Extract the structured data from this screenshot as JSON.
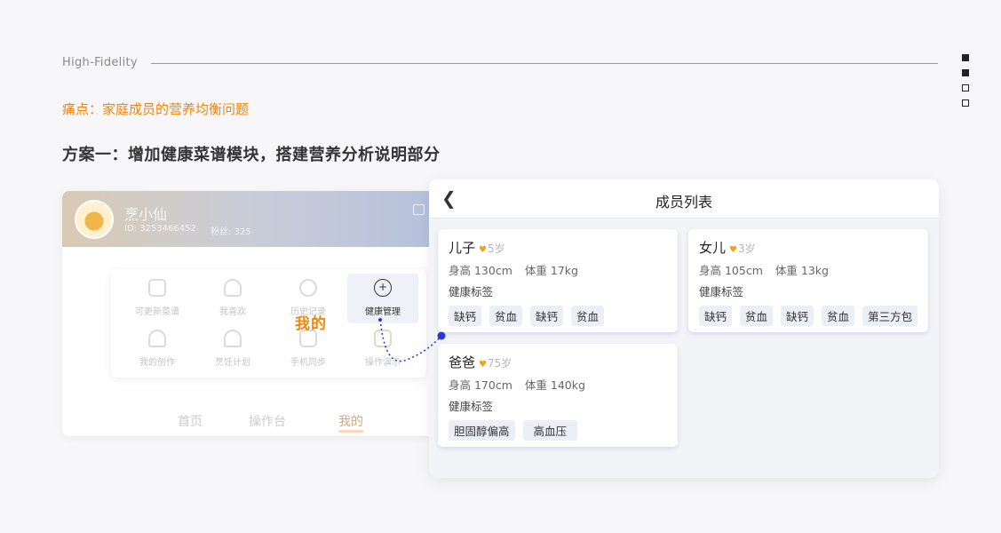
{
  "header": {
    "label": "High-Fidelity",
    "pain_point": "痛点：家庭成员的营养均衡问题",
    "plan": "方案一：增加健康菜谱模块，搭建营养分析说明部分"
  },
  "pager": {
    "total": 4,
    "active": [
      0,
      1
    ]
  },
  "profile": {
    "name": "烹小仙",
    "id": "ID: 3253466452",
    "fans": "粉丝: 325",
    "grid": [
      {
        "label": "可更新菜谱",
        "icon": "recipe-edit-icon"
      },
      {
        "label": "我喜欢",
        "icon": "heart-icon"
      },
      {
        "label": "历史记录",
        "icon": "history-icon"
      },
      {
        "label": "健康管理",
        "icon": "health-drop-icon"
      },
      {
        "label": "我的创作",
        "icon": "chef-hat-icon"
      },
      {
        "label": "烹饪计划",
        "icon": "cloche-icon"
      },
      {
        "label": "手机同步",
        "icon": "sync-icon"
      },
      {
        "label": "操作演示",
        "icon": "demo-icon"
      }
    ],
    "nav": [
      "首页",
      "操作台",
      "我的"
    ],
    "callout": "我的"
  },
  "member_list": {
    "title": "成员列表",
    "tag_title": "健康标签",
    "members": [
      {
        "name": "儿子",
        "age": "5岁",
        "height": "身高 130cm",
        "weight": "体重 17kg",
        "tags": [
          "缺钙",
          "贫血",
          "缺钙",
          "贫血"
        ]
      },
      {
        "name": "女儿",
        "age": "3岁",
        "height": "身高 105cm",
        "weight": "体重 13kg",
        "tags": [
          "缺钙",
          "贫血",
          "缺钙",
          "贫血",
          "第三方包"
        ]
      },
      {
        "name": "爸爸",
        "age": "75岁",
        "height": "身高 170cm",
        "weight": "体重 140kg",
        "tags": [
          "胆固醇偏高",
          "高血压"
        ]
      }
    ]
  },
  "colors": {
    "accent": "#f5850a",
    "connector": "#2639d8"
  }
}
